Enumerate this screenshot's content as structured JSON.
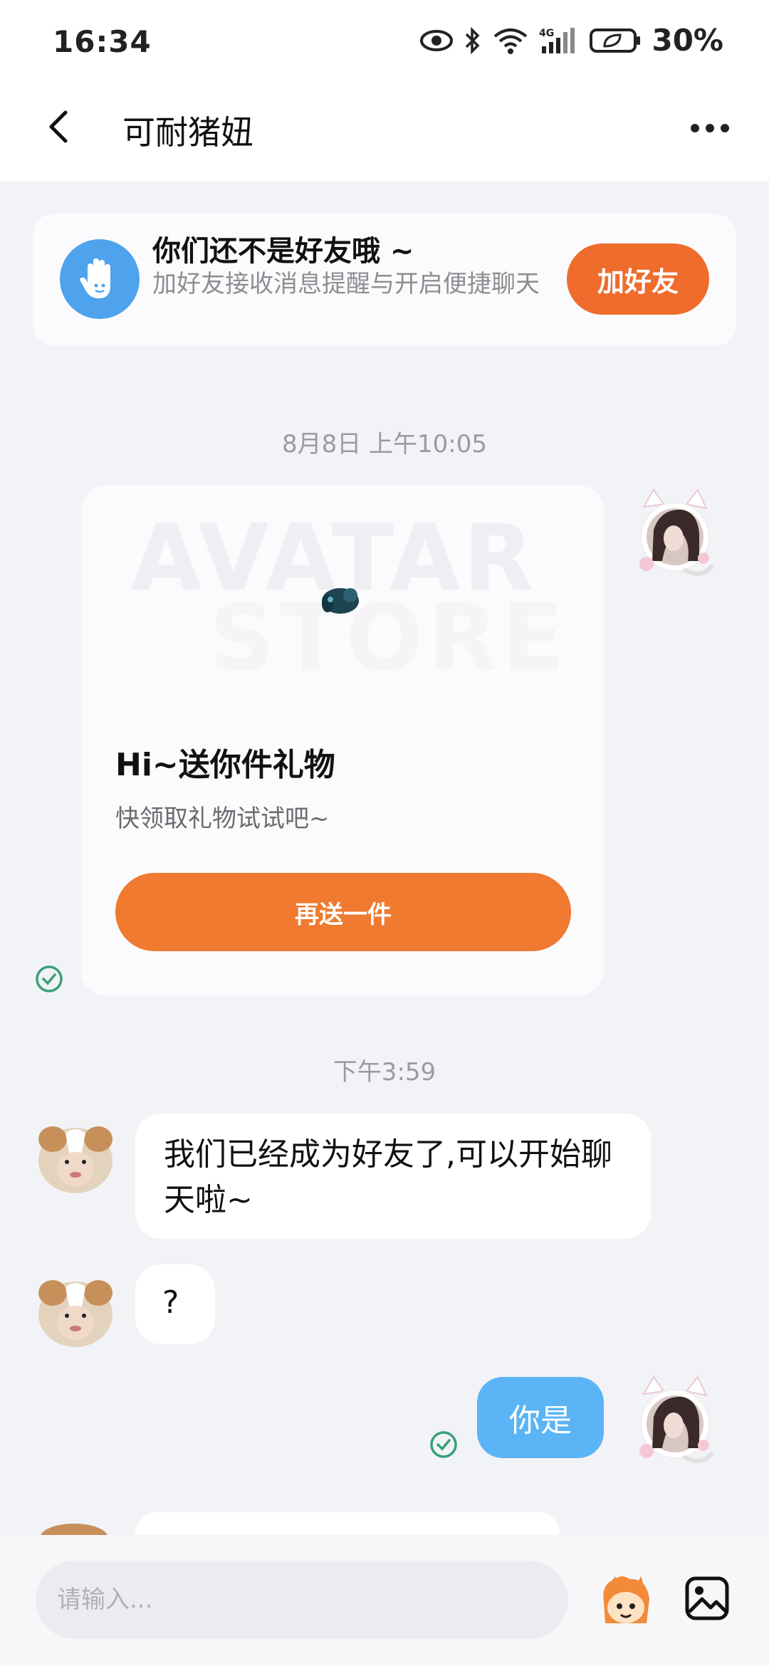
{
  "status_bar": {
    "time": "16:34",
    "battery": "30%"
  },
  "header": {
    "title": "可耐猪妞"
  },
  "banner": {
    "title": "你们还不是好友哦 ~",
    "subtitle": "加好友接收消息提醒与开启便捷聊天",
    "button": "加好友"
  },
  "messages": {
    "ts1": "8月8日 上午10:05",
    "gift": {
      "watermark_line1": "AVATAR",
      "watermark_line2": "STORE",
      "title": "Hi~送你件礼物",
      "subtitle": "快领取礼物试试吧~",
      "button": "再送一件"
    },
    "ts2": "下午3:59",
    "msg1": "我们已经成为好友了,可以开始聊天啦~",
    "msg2": "?",
    "msg3": "你是"
  },
  "input": {
    "placeholder": "请输入..."
  },
  "icons": {
    "back": "chevron-left-icon",
    "more": "more-icon",
    "hand": "hand-icon",
    "check": "check-circle-icon",
    "emoji": "emoji-sticker-icon",
    "image": "image-icon"
  },
  "colors": {
    "accent": "#ef6c2d",
    "bubble_self": "#5bb4f5",
    "check_green": "#3a9f7a"
  }
}
